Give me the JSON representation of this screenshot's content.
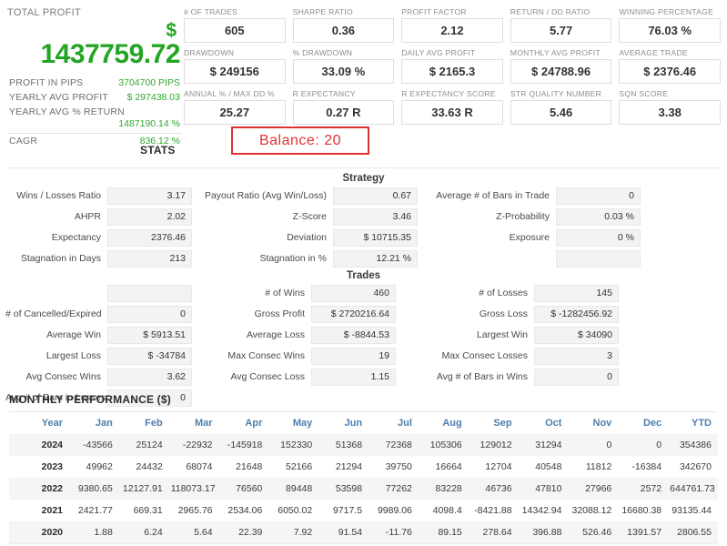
{
  "headline": {
    "title": "TOTAL PROFIT",
    "currency_symbol": "$",
    "total_profit": "1437759.72",
    "rows": [
      {
        "label": "PROFIT IN PIPS",
        "value": "3704700 PIPS"
      },
      {
        "label": "YEARLY AVG PROFIT",
        "value": "$ 297438.03"
      },
      {
        "label": "YEARLY AVG % RETURN",
        "value": "1487190.14 %"
      },
      {
        "label": "CAGR",
        "value": "836.12 %"
      }
    ],
    "stats_word": "STATS"
  },
  "annotation": {
    "text": "Balance: 20",
    "border_color": "#e03232",
    "text_color": "#e03232"
  },
  "colors": {
    "profit_green": "#24a524",
    "negative_red": "#e2604f",
    "table_header_blue": "#4d7fad",
    "field_bg": "#f3f3f3"
  },
  "cards": [
    {
      "label": "# OF TRADES",
      "value": "605"
    },
    {
      "label": "SHARPE RATIO",
      "value": "0.36"
    },
    {
      "label": "PROFIT FACTOR",
      "value": "2.12"
    },
    {
      "label": "RETURN / DD RATIO",
      "value": "5.77"
    },
    {
      "label": "WINNING PERCENTAGE",
      "value": "76.03 %"
    },
    {
      "label": "DRAWDOWN",
      "value": "$ 249156"
    },
    {
      "label": "% DRAWDOWN",
      "value": "33.09 %"
    },
    {
      "label": "DAILY AVG PROFIT",
      "value": "$ 2165.3"
    },
    {
      "label": "MONTHLY AVG PROFIT",
      "value": "$ 24788.96"
    },
    {
      "label": "AVERAGE TRADE",
      "value": "$ 2376.46"
    },
    {
      "label": "ANNUAL % / MAX DD %",
      "value": "25.27"
    },
    {
      "label": "R EXPECTANCY",
      "value": "0.27 R"
    },
    {
      "label": "R EXPECTANCY SCORE",
      "value": "33.63 R"
    },
    {
      "label": "STR QUALITY NUMBER",
      "value": "5.46"
    },
    {
      "label": "SQN SCORE",
      "value": "3.38"
    }
  ],
  "strategy": {
    "title": "Strategy",
    "fields": [
      {
        "label": "Wins / Losses Ratio",
        "value": "3.17"
      },
      {
        "label": "Payout Ratio (Avg Win/Loss)",
        "value": "0.67"
      },
      {
        "label": "Average # of Bars in Trade",
        "value": "0"
      },
      {
        "label": "AHPR",
        "value": "2.02"
      },
      {
        "label": "Z-Score",
        "value": "3.46"
      },
      {
        "label": "Z-Probability",
        "value": "0.03 %"
      },
      {
        "label": "Expectancy",
        "value": "2376.46"
      },
      {
        "label": "Deviation",
        "value": "$ 10715.35"
      },
      {
        "label": "Exposure",
        "value": "0 %"
      },
      {
        "label": "Stagnation in Days",
        "value": "213"
      },
      {
        "label": "Stagnation in %",
        "value": "12.21 %"
      },
      {
        "label": "",
        "value": ""
      }
    ]
  },
  "trades": {
    "title": "Trades",
    "fields": [
      {
        "label": "",
        "value": ""
      },
      {
        "label": "# of Wins",
        "value": "460"
      },
      {
        "label": "# of Losses",
        "value": "145"
      },
      {
        "label": "# of Cancelled/Expired",
        "value": "0"
      },
      {
        "label": "Gross Profit",
        "value": "$ 2720216.64"
      },
      {
        "label": "Gross Loss",
        "value": "$ -1282456.92"
      },
      {
        "label": "Average Win",
        "value": "$ 5913.51"
      },
      {
        "label": "Average Loss",
        "value": "$ -8844.53"
      },
      {
        "label": "Largest Win",
        "value": "$ 34090"
      },
      {
        "label": "Largest Loss",
        "value": "$ -34784"
      },
      {
        "label": "Max Consec Wins",
        "value": "19"
      },
      {
        "label": "Max Consec Losses",
        "value": "3"
      },
      {
        "label": "Avg Consec Wins",
        "value": "3.62"
      },
      {
        "label": "Avg Consec Loss",
        "value": "1.15"
      },
      {
        "label": "Avg # of Bars in Wins",
        "value": "0"
      },
      {
        "label": "Avg # of Bars in Losses",
        "value": "0"
      }
    ]
  },
  "monthly_performance": {
    "title": "MONTHLY PERFORMANCE ($)",
    "columns": [
      "Year",
      "Jan",
      "Feb",
      "Mar",
      "Apr",
      "May",
      "Jun",
      "Jul",
      "Aug",
      "Sep",
      "Oct",
      "Nov",
      "Dec",
      "YTD"
    ],
    "rows": [
      {
        "year": "2024",
        "values": [
          "-43566",
          "25124",
          "-22932",
          "-145918",
          "152330",
          "51368",
          "72368",
          "105306",
          "129012",
          "31294",
          "0",
          "0",
          "354386"
        ]
      },
      {
        "year": "2023",
        "values": [
          "49962",
          "24432",
          "68074",
          "21648",
          "52166",
          "21294",
          "39750",
          "16664",
          "12704",
          "40548",
          "11812",
          "-16384",
          "342670"
        ]
      },
      {
        "year": "2022",
        "values": [
          "9380.65",
          "12127.91",
          "118073.17",
          "76560",
          "89448",
          "53598",
          "77262",
          "83228",
          "46736",
          "47810",
          "27966",
          "2572",
          "644761.73"
        ]
      },
      {
        "year": "2021",
        "values": [
          "2421.77",
          "669.31",
          "2965.76",
          "2534.06",
          "6050.02",
          "9717.5",
          "9989.06",
          "4098.4",
          "-8421.88",
          "14342.94",
          "32088.12",
          "16680.38",
          "93135.44"
        ]
      },
      {
        "year": "2020",
        "values": [
          "1.88",
          "6.24",
          "5.64",
          "22.39",
          "7.92",
          "91.54",
          "-11.76",
          "89.15",
          "278.64",
          "396.88",
          "526.46",
          "1391.57",
          "2806.55"
        ]
      }
    ]
  }
}
